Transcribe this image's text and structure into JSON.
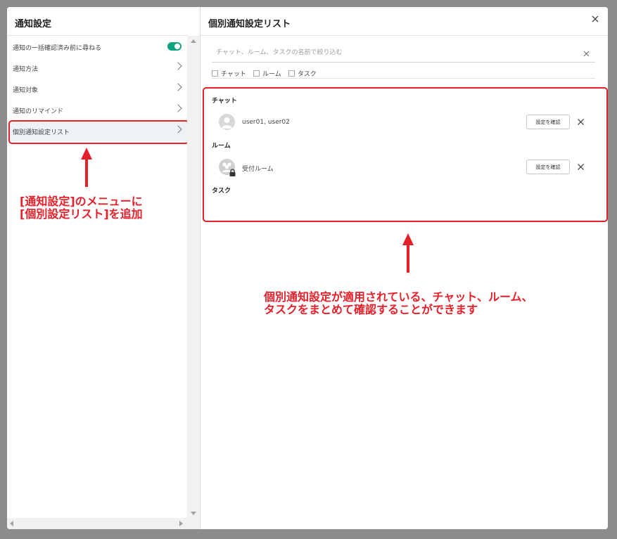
{
  "left": {
    "title": "通知設定",
    "items": [
      {
        "label": "通知の一括確認済み前に尋ねる",
        "control": "toggle",
        "toggle_on": true
      },
      {
        "label": "通知方法",
        "control": "chevron"
      },
      {
        "label": "通知対象",
        "control": "chevron"
      },
      {
        "label": "通知のリマインド",
        "control": "chevron"
      },
      {
        "label": "個別通知設定リスト",
        "control": "chevron",
        "selected": true
      }
    ],
    "annotation": [
      "[通知設定]のメニューに",
      "[個別設定リスト]を追加"
    ]
  },
  "right": {
    "title": "個別通知設定リスト",
    "search_placeholder": "チャット、ルーム、タスクの名前で絞り込む",
    "filters": [
      "チャット",
      "ルーム",
      "タスク"
    ],
    "sections": {
      "chat": {
        "heading": "チャット",
        "row_label": "user01, user02",
        "button": "設定を確認"
      },
      "room": {
        "heading": "ルーム",
        "row_label": "受付ルーム",
        "button": "設定を確認"
      },
      "task": {
        "heading": "タスク"
      }
    },
    "annotation": [
      "個別通知設定が適用されている、チャット、ルーム、",
      "タスクをまとめて確認することができます"
    ]
  },
  "colors": {
    "accent": "#10a37f",
    "annotation": "#e5202a"
  }
}
